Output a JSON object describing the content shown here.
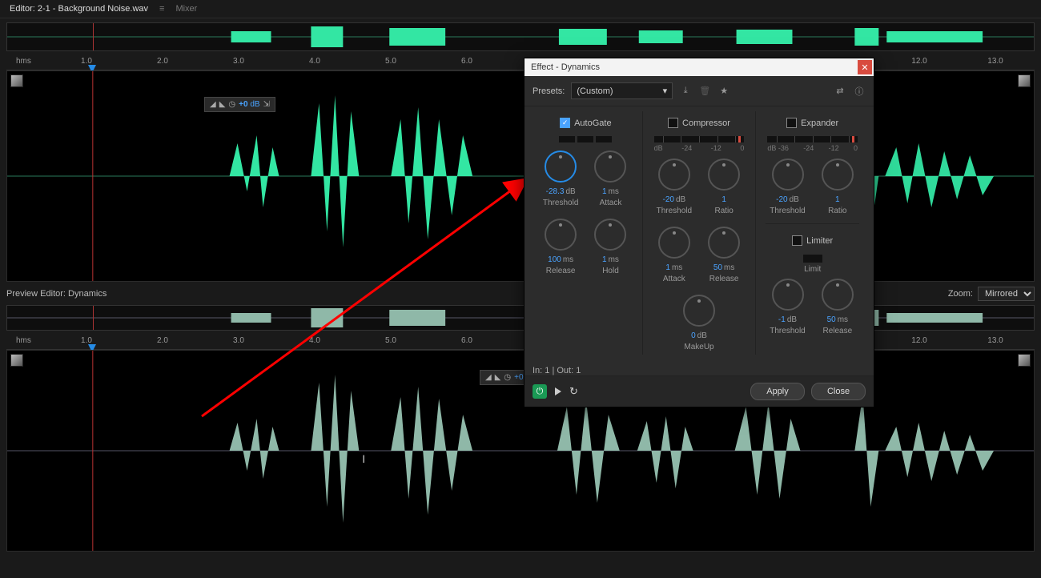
{
  "tabs": {
    "editor": "Editor: 2-1 - Background Noise.wav",
    "mixer": "Mixer"
  },
  "ruler_label": "hms",
  "ticks": [
    "1.0",
    "2.0",
    "3.0",
    "4.0",
    "5.0",
    "6.0",
    "12.0",
    "13.0"
  ],
  "tick_pos": [
    100,
    195,
    290,
    385,
    480,
    575,
    1140,
    1235
  ],
  "hud": {
    "db": "+0",
    "unit": "dB"
  },
  "preview": {
    "title": "Preview Editor: Dynamics",
    "zoom_label": "Zoom:",
    "zoom_value": "Mirrored"
  },
  "dlg": {
    "title": "Effect - Dynamics",
    "presets_label": "Presets:",
    "preset_value": "(Custom)",
    "autogate": {
      "title": "AutoGate",
      "threshold": "-28.3",
      "attack": "1",
      "release": "100",
      "hold": "1"
    },
    "compressor": {
      "title": "Compressor",
      "mlbls": [
        "dB",
        "-24",
        "-12",
        "0"
      ],
      "threshold": "-20",
      "ratio": "1",
      "attack": "1",
      "release": "50",
      "makeup": "0"
    },
    "expander": {
      "title": "Expander",
      "mlbls": [
        "dB -36",
        "-24",
        "-12",
        "0"
      ],
      "threshold": "-20",
      "ratio": "1"
    },
    "limiter": {
      "title": "Limiter",
      "limit": "Limit",
      "threshold": "-1",
      "release": "50"
    },
    "labels": {
      "threshold": "Threshold",
      "attack": "Attack",
      "release": "Release",
      "hold": "Hold",
      "ratio": "Ratio",
      "makeup": "MakeUp",
      "limit": "Limit"
    },
    "units": {
      "db": "dB",
      "ms": "ms"
    },
    "io": "In: 1 | Out: 1",
    "apply": "Apply",
    "close": "Close"
  }
}
